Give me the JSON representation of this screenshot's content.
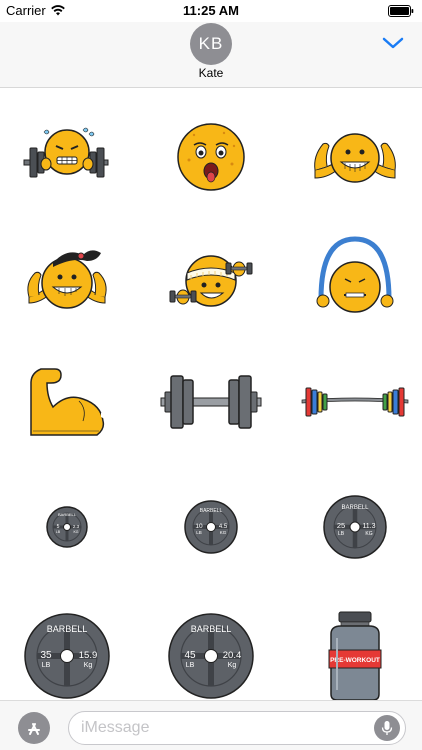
{
  "status_bar": {
    "carrier": "Carrier",
    "time": "11:25 AM"
  },
  "header": {
    "avatar_initials": "KB",
    "contact_name": "Kate"
  },
  "stickers": [
    {
      "name": "Sweating emoji lifting barbell"
    },
    {
      "name": "Exhausted sweaty emoji"
    },
    {
      "name": "Emoji flexing biceps"
    },
    {
      "name": "Emoji with ponytail flexing"
    },
    {
      "name": "Emoji with headband lifting dumbbells"
    },
    {
      "name": "Emoji with jump rope"
    },
    {
      "name": "Flexed bicep arm"
    },
    {
      "name": "Dumbbell"
    },
    {
      "name": "Barbell with colored plates"
    },
    {
      "name": "Small weight plate",
      "brand": "BARBELL",
      "lb": "5",
      "lb_unit": "LB",
      "kg": "2.3",
      "kg_unit": "KG"
    },
    {
      "name": "10 lb weight plate",
      "brand": "BARBELL",
      "lb": "10",
      "lb_unit": "LB",
      "kg": "4.5",
      "kg_unit": "KG"
    },
    {
      "name": "25 lb weight plate",
      "brand": "BARBELL",
      "lb": "25",
      "lb_unit": "LB",
      "kg": "11.3",
      "kg_unit": "KG"
    },
    {
      "name": "35 lb weight plate",
      "brand": "BARBELL",
      "lb": "35",
      "lb_unit": "LB",
      "kg": "15.9",
      "kg_unit": "Kg"
    },
    {
      "name": "45 lb weight plate",
      "brand": "BARBELL",
      "lb": "45",
      "lb_unit": "LB",
      "kg": "20.4",
      "kg_unit": "Kg"
    },
    {
      "name": "Pre-workout tub",
      "label": "PRE-WORKOUT"
    }
  ],
  "input_bar": {
    "placeholder": "iMessage"
  },
  "colors": {
    "emoji_yellow": "#f8b717",
    "plate_gray": "#5d6167",
    "accent_blue": "#1a7cf5"
  }
}
